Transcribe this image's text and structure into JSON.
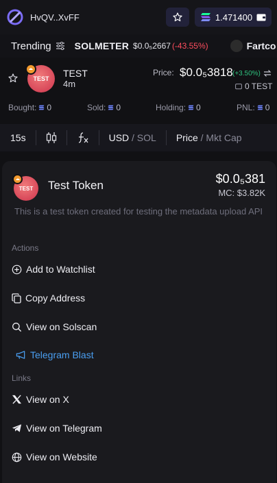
{
  "topbar": {
    "wallet": "HvQV..XvFF",
    "balance": "1.471400"
  },
  "ticker": {
    "trending_label": "Trending",
    "items": [
      {
        "name": "SOLMETER",
        "price": "$0.0₅2667",
        "change": "(-43.55%)"
      },
      {
        "name": "Fartco"
      }
    ]
  },
  "token": {
    "avatar_text": "TEST",
    "name": "TEST",
    "age": "4m",
    "price_label": "Price:",
    "price": "$0.0₅3818",
    "change": "(+3.50%)",
    "holdings": "0 TEST"
  },
  "stats": [
    {
      "label": "Bought:",
      "value": "0"
    },
    {
      "label": "Sold:",
      "value": "0"
    },
    {
      "label": "Holding:",
      "value": "0"
    },
    {
      "label": "PNL:",
      "value": "0"
    }
  ],
  "chart_toolbar": {
    "interval": "15s",
    "currency_active": "USD",
    "currency_alt": "/ SOL",
    "metric_active": "Price",
    "metric_alt": "/ Mkt Cap"
  },
  "card": {
    "avatar_text": "TEST",
    "title": "Test Token",
    "price": "$0.0₅381",
    "mc": "MC: $3.82K",
    "description": "This is a test token created for testing the metadata upload API",
    "actions_label": "Actions",
    "actions": [
      {
        "label": "Add to Watchlist",
        "icon": "plus-circle-icon"
      },
      {
        "label": "Copy Address",
        "icon": "copy-icon"
      },
      {
        "label": "View on Solscan",
        "icon": "search-icon"
      },
      {
        "label": "Telegram Blast",
        "icon": "megaphone-icon",
        "color": "#4a9ff2"
      }
    ],
    "links_label": "Links",
    "links": [
      {
        "label": "View on X",
        "icon": "x-logo-icon"
      },
      {
        "label": "View on Telegram",
        "icon": "telegram-icon"
      },
      {
        "label": "View on Website",
        "icon": "globe-icon"
      }
    ]
  },
  "colors": {
    "background": "#111114",
    "card": "#1a1a1e",
    "accent_blue": "#4a9ff2",
    "positive": "#2ec27e",
    "negative": "#ff4d5e",
    "token_avatar": "#e05a66",
    "badge": "#f29a2e"
  }
}
